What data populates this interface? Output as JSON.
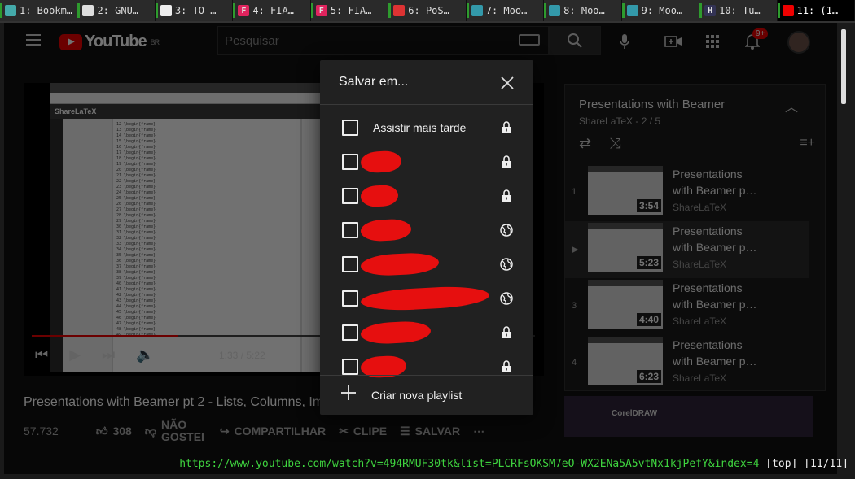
{
  "browser_tabs": [
    {
      "label": "1: Bookm…",
      "fav": "",
      "fav_color": "#4aa"
    },
    {
      "label": "2: GNU…",
      "fav": "G",
      "fav_color": "#ddd"
    },
    {
      "label": "3: TO-…",
      "fav": "",
      "fav_color": "#eee"
    },
    {
      "label": "4: FIA…",
      "fav": "F",
      "fav_color": "#e0245e"
    },
    {
      "label": "5: FIA…",
      "fav": "F",
      "fav_color": "#e0245e"
    },
    {
      "label": "6: PoS…",
      "fav": "",
      "fav_color": "#d33"
    },
    {
      "label": "7: Moo…",
      "fav": "",
      "fav_color": "#39a"
    },
    {
      "label": "8: Moo…",
      "fav": "",
      "fav_color": "#39a"
    },
    {
      "label": "9: Moo…",
      "fav": "",
      "fav_color": "#39a"
    },
    {
      "label": "10: Tu…",
      "fav": "H",
      "fav_color": "#335"
    },
    {
      "label": "11: (1…",
      "fav": "",
      "fav_color": "#e00"
    }
  ],
  "header": {
    "logo_text": "YouTube",
    "region": "BR",
    "search_placeholder": "Pesquisar",
    "notifications_count": "9+"
  },
  "player": {
    "current_time": "1:33 / 5:22",
    "progress": 0.29,
    "screen_app": "ShareLaTeX"
  },
  "video": {
    "title": "Presentations with Beamer pt 2 - Lists, Columns, Images",
    "views": "57.732",
    "likes": "308",
    "dislike_label": "NÃO GOSTEI",
    "share_label": "COMPARTILHAR",
    "clip_label": "CLIPE",
    "save_label": "SALVAR"
  },
  "playlist": {
    "title": "Presentations with Beamer",
    "subtitle": "ShareLaTeX - 2 / 5",
    "items": [
      {
        "num": "1",
        "title": "Presentations with Beamer p…",
        "channel": "ShareLaTeX",
        "duration": "3:54"
      },
      {
        "num": "▶",
        "title": "Presentations with Beamer p…",
        "channel": "ShareLaTeX",
        "duration": "5:23"
      },
      {
        "num": "3",
        "title": "Presentations with Beamer p…",
        "channel": "ShareLaTeX",
        "duration": "4:40"
      },
      {
        "num": "4",
        "title": "Presentations with Beamer p…",
        "channel": "ShareLaTeX",
        "duration": "6:23"
      }
    ]
  },
  "ad": {
    "text": "CorelDRAW"
  },
  "dialog": {
    "title": "Salvar em...",
    "first_row_label": "Assistir mais tarde",
    "create_label": "Criar nova playlist",
    "rows": [
      {
        "privacy": "lock"
      },
      {
        "privacy": "lock"
      },
      {
        "privacy": "lock"
      },
      {
        "privacy": "globe"
      },
      {
        "privacy": "globe"
      },
      {
        "privacy": "globe"
      },
      {
        "privacy": "lock"
      },
      {
        "privacy": "lock"
      }
    ]
  },
  "statusbar": {
    "url": "https://www.youtube.com/watch?v=494RMUF30tk&list=PLCRFsOKSM7eO-WX2ENa5A5vtNx1kjPefY&index=4",
    "rest": "[top] [11/11]"
  }
}
